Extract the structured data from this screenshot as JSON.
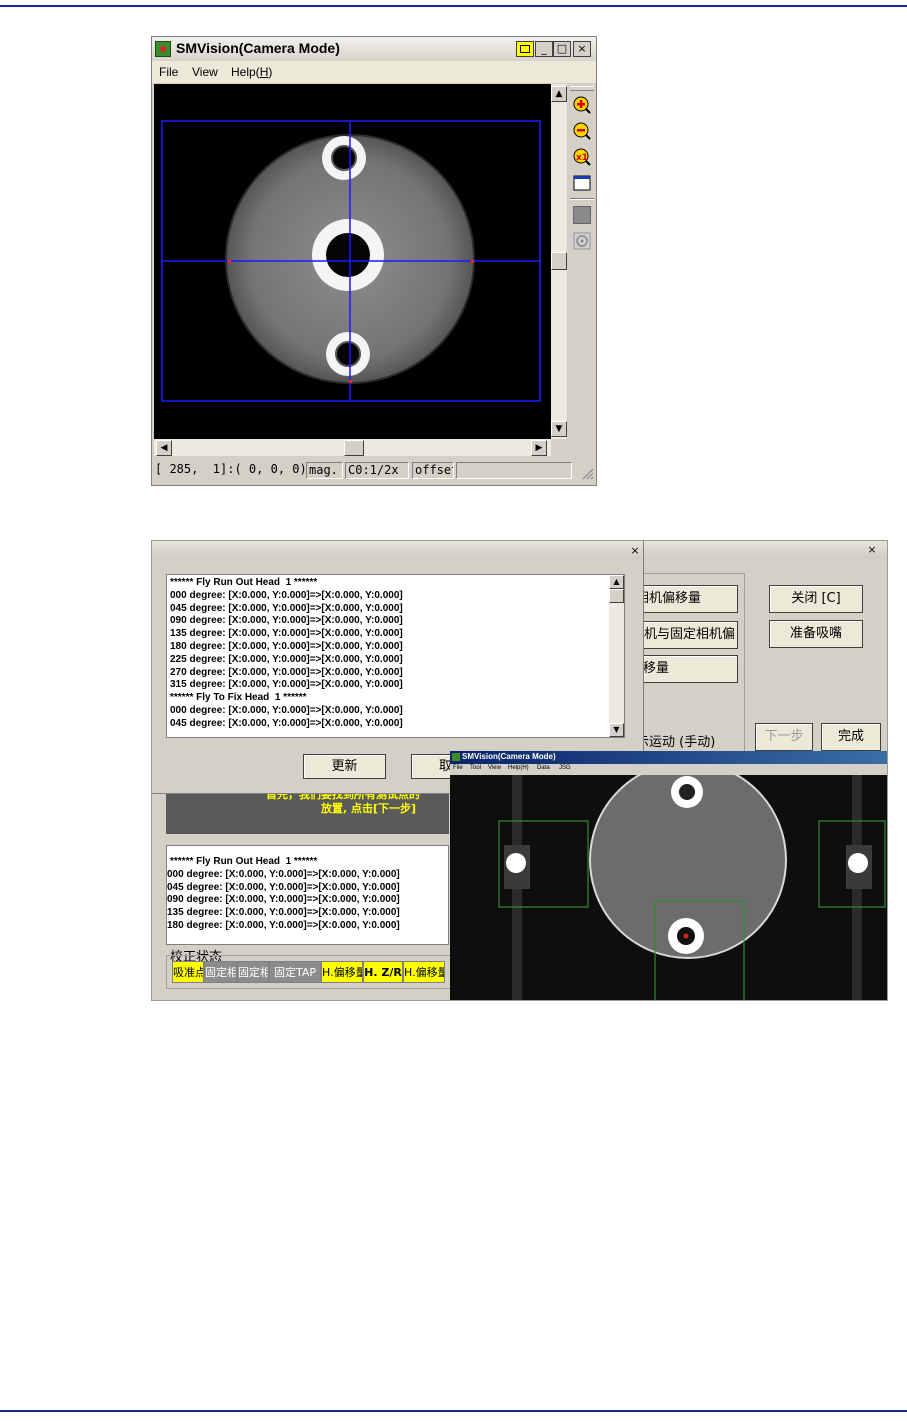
{
  "camera_window": {
    "title": "SMVision(Camera Mode)",
    "menu": [
      "File",
      "View",
      "Help(H)"
    ],
    "menu_help_label": "Help(",
    "menu_help_key": "H",
    "menu_help_close": ")",
    "title_buttons": [
      "_",
      "□",
      "×"
    ],
    "tools": [
      "zoom-in-icon",
      "zoom-out-icon",
      "zoom-1x-icon",
      "fit-window-icon",
      "gray-square-icon",
      "snapshot-icon"
    ],
    "status": {
      "coords": "[ 285,  1]:( 0, 0, 0)",
      "mag_label": "mag.",
      "mag_value": "C0:1/2x",
      "offset_label": "offset",
      "offset_value": ""
    }
  },
  "calibration_dialog": {
    "log_lines": [
      "****** Fly Run Out Head  1 ******",
      "000 degree: [X:0.000, Y:0.000]=>[X:0.000, Y:0.000]",
      "045 degree: [X:0.000, Y:0.000]=>[X:0.000, Y:0.000]",
      "090 degree: [X:0.000, Y:0.000]=>[X:0.000, Y:0.000]",
      "135 degree: [X:0.000, Y:0.000]=>[X:0.000, Y:0.000]",
      "180 degree: [X:0.000, Y:0.000]=>[X:0.000, Y:0.000]",
      "225 degree: [X:0.000, Y:0.000]=>[X:0.000, Y:0.000]",
      "270 degree: [X:0.000, Y:0.000]=>[X:0.000, Y:0.000]",
      "315 degree: [X:0.000, Y:0.000]=>[X:0.000, Y:0.000]",
      "****** Fly To Fix Head  1 ******",
      "000 degree: [X:0.000, Y:0.000]=>[X:0.000, Y:0.000]",
      "045 degree: [X:0.000, Y:0.000]=>[X:0.000, Y:0.000]"
    ],
    "update_button": "更新",
    "cancel_button_partial": "取"
  },
  "back_dialog": {
    "buttons": {
      "camera_offset": "相机偏移量",
      "camera_fixed_offset": "相机与固定相机偏",
      "offset": "移量",
      "close": "关闭 [C]",
      "prepare_nozzle": "准备吸嘴",
      "next_step": "下一步",
      "finish": "完成"
    },
    "motion_label": "示运动 (手动)",
    "instruction_line1": "首先，我们要找到所有测试点的",
    "instruction_line2": "放置, 点击[下一步]",
    "log_lines": [
      "****** Fly Run Out Head  1 ******",
      "000 degree: [X:0.000, Y:0.000]=>[X:0.000, Y:0.000]",
      "045 degree: [X:0.000, Y:0.000]=>[X:0.000, Y:0.000]",
      "090 degree: [X:0.000, Y:0.000]=>[X:0.000, Y:0.000]",
      "135 degree: [X:0.000, Y:0.000]=>[X:0.000, Y:0.000]",
      "180 degree: [X:0.000, Y:0.000]=>[X:0.000, Y:0.000]"
    ],
    "status_group_label": "校正状态",
    "status_cells": [
      "吸准点",
      "固定相",
      "固定相",
      "固定TAP",
      "H.偏移量",
      "H. Z/R",
      "H.偏移量"
    ]
  },
  "camera_window_small": {
    "title": "SMVision(Camera Mode)",
    "menu": [
      "File",
      "Tool",
      "View",
      "Help(H)",
      "Data",
      "JSG"
    ]
  }
}
